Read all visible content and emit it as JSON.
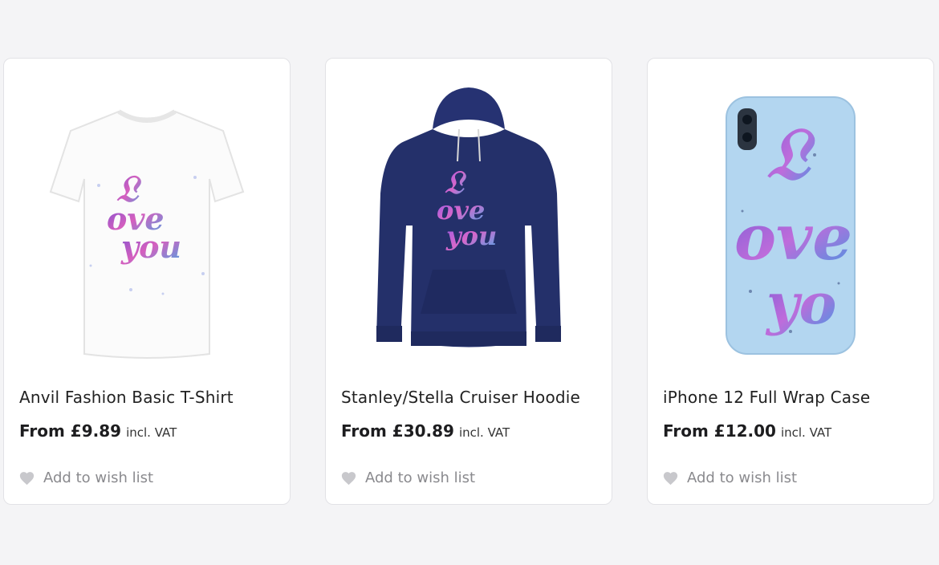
{
  "products": [
    {
      "title": "Anvil Fashion Basic T-Shirt",
      "price": "From £9.89",
      "vat": "incl. VAT",
      "wish_label": "Add to wish list",
      "image": "white-tshirt-image"
    },
    {
      "title": "Stanley/Stella Cruiser Hoodie",
      "price": "From £30.89",
      "vat": "incl. VAT",
      "wish_label": "Add to wish list",
      "image": "navy-hoodie-image"
    },
    {
      "title": "iPhone 12 Full Wrap Case",
      "price": "From £12.00",
      "vat": "incl. VAT",
      "wish_label": "Add to wish list",
      "image": "phone-case-image"
    }
  ],
  "colors": {
    "page_bg": "#f4f4f6",
    "card_bg": "#ffffff",
    "heart": "#c8c8cc",
    "hoodie": "#24306a",
    "case": "#b3d6f0"
  }
}
